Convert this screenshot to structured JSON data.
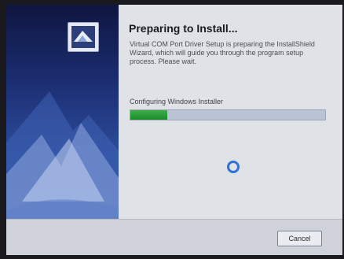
{
  "dialog": {
    "title": "Preparing to Install...",
    "description": "Virtual COM Port Driver Setup is preparing the InstallShield Wizard, which will guide you through the program setup process. Please wait.",
    "status": "Configuring Windows Installer",
    "progress_fraction": 0.19,
    "cancel_label": "Cancel"
  },
  "colors": {
    "progress_fill": "#2a9a38",
    "spinner": "#2f73d8",
    "side_panel": "#1b2d70"
  },
  "icons": {
    "logo": "installshield-logo-icon",
    "spinner": "loading-spinner-icon"
  }
}
